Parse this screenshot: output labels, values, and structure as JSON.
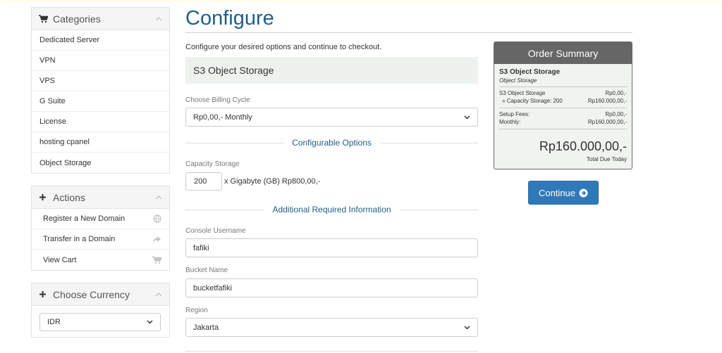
{
  "sidebar": {
    "categories": {
      "title": "Categories",
      "items": [
        {
          "label": "Dedicated Server"
        },
        {
          "label": "VPN"
        },
        {
          "label": "VPS"
        },
        {
          "label": "G Suite"
        },
        {
          "label": "License"
        },
        {
          "label": "hosting cpanel"
        },
        {
          "label": "Object Storage"
        }
      ]
    },
    "actions": {
      "title": "Actions",
      "items": [
        {
          "label": "Register a New Domain",
          "icon": "globe-icon"
        },
        {
          "label": "Transfer in a Domain",
          "icon": "share-icon"
        },
        {
          "label": "View Cart",
          "icon": "cart-icon"
        }
      ]
    },
    "currency": {
      "title": "Choose Currency",
      "selected": "IDR"
    }
  },
  "main": {
    "title": "Configure",
    "intro": "Configure your desired options and continue to checkout.",
    "product_name": "S3 Object Storage",
    "billing": {
      "label": "Choose Billing Cycle",
      "selected": "Rp0,00,- Monthly"
    },
    "configurable_options": {
      "heading": "Configurable Options",
      "capacity_label": "Capacity Storage",
      "capacity_value": "200",
      "capacity_unit": "x Gigabyte (GB) Rp800,00,-"
    },
    "additional_info": {
      "heading": "Additional Required Information",
      "console_username_label": "Console Username",
      "console_username_value": "fafiki",
      "bucket_name_label": "Bucket Name",
      "bucket_name_value": "bucketfafiki",
      "region_label": "Region",
      "region_value": "Jakarta"
    }
  },
  "summary": {
    "title": "Order Summary",
    "product": "S3 Object Storage",
    "group": "Object Storage",
    "lines": [
      {
        "label": "S3 Object Storage",
        "value": "Rp0,00,-"
      },
      {
        "label": "» Capacity Storage: 200",
        "value": "Rp160.000,00,-"
      }
    ],
    "fees": [
      {
        "label": "Setup Fees:",
        "value": "Rp0,00,-"
      },
      {
        "label": "Monthly:",
        "value": "Rp160.000,00,-"
      }
    ],
    "total": "Rp160.000,00,-",
    "total_label": "Total Due Today"
  },
  "continue_button": "Continue",
  "colors": {
    "accent": "#1e5f8a",
    "button": "#2f79b9",
    "summary_header": "#666666",
    "summary_bg": "#f0f3f0"
  }
}
